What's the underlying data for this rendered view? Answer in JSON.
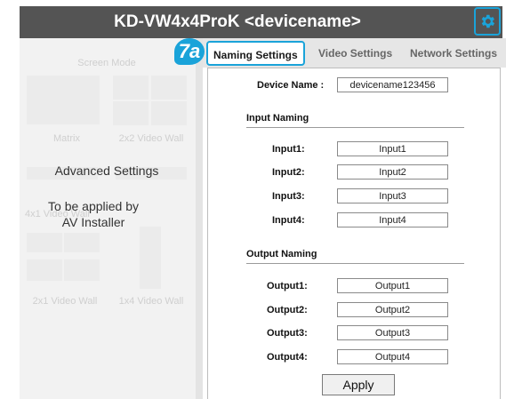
{
  "header": {
    "title": "KD-VW4x4ProK <devicename>",
    "settings_icon": "gear-icon",
    "accent_color": "#1aa3d9"
  },
  "left_panel": {
    "screen_mode_label": "Screen Mode",
    "modes": [
      "Matrix",
      "2x2 Video Wall",
      "4x1 Video Wall",
      "2x1 Video Wall",
      "1x4 Video Wall"
    ],
    "advanced_title": "Advanced Settings",
    "advanced_note_line1": "To be applied by",
    "advanced_note_line2": "AV Installer"
  },
  "callout": {
    "label": "7a"
  },
  "tabs": [
    "Naming Settings",
    "Video Settings",
    "Network Settings"
  ],
  "form": {
    "device_name_label": "Device Name :",
    "device_name_value": "devicename123456",
    "input_section": "Input Naming",
    "inputs": [
      {
        "label": "Input1:",
        "value": "Input1"
      },
      {
        "label": "Input2:",
        "value": "Input2"
      },
      {
        "label": "Input3:",
        "value": "Input3"
      },
      {
        "label": "Input4:",
        "value": "Input4"
      }
    ],
    "output_section": "Output Naming",
    "outputs": [
      {
        "label": "Output1:",
        "value": "Output1"
      },
      {
        "label": "Output2:",
        "value": "Output2"
      },
      {
        "label": "Output3:",
        "value": "Output3"
      },
      {
        "label": "Output4:",
        "value": "Output4"
      }
    ],
    "apply_label": "Apply"
  }
}
